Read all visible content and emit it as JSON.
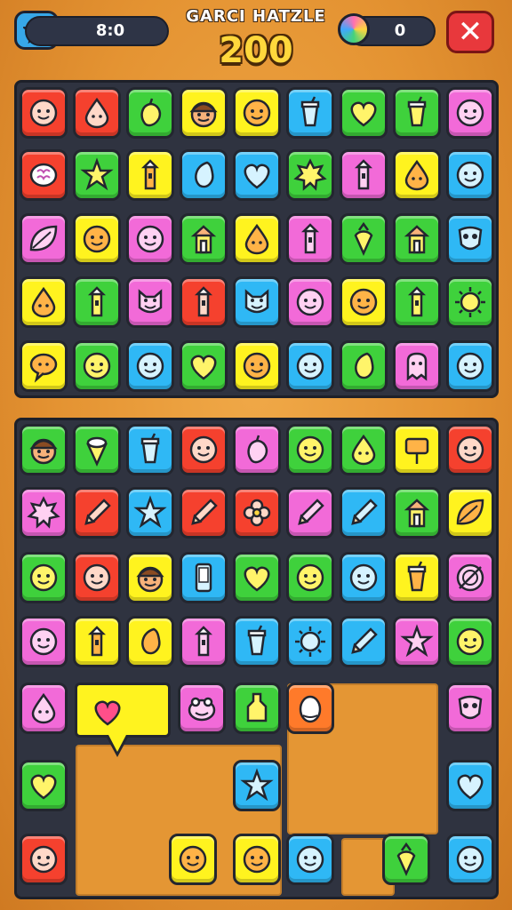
{
  "hud": {
    "title": "GARCI HATZLE",
    "score": "200",
    "coins": "8:0",
    "gems": "0",
    "icons": [
      "star-icon",
      "avatar-icon",
      "close-icon"
    ],
    "colors": {
      "score": "#ffd83c",
      "close": "#e8383c",
      "star_button": "#37a7e8",
      "star": "#ffd640"
    }
  },
  "palette": {
    "red": "#f5412e",
    "blue": "#2fb8f5",
    "green": "#3fd13c",
    "yellow": "#fff31f",
    "pink": "#f26ad8",
    "lime": "#8fe83a",
    "orange": "#ff7a2a"
  },
  "boards": {
    "top": {
      "rows": [
        [
          {
            "c": "red",
            "i": "face-icon"
          },
          {
            "c": "red",
            "i": "drop-icon"
          },
          {
            "c": "green",
            "i": "pepper-icon"
          },
          {
            "c": "yellow",
            "i": "boy-face-icon"
          },
          {
            "c": "yellow",
            "i": "face-icon"
          },
          {
            "c": "blue",
            "i": "cup-icon"
          },
          {
            "c": "green",
            "i": "heart-icon"
          },
          {
            "c": "green",
            "i": "cup-icon"
          },
          {
            "c": "pink",
            "i": "face-icon"
          }
        ],
        [
          {
            "c": "red",
            "i": "shell-icon"
          },
          {
            "c": "green",
            "i": "star-icon"
          },
          {
            "c": "yellow",
            "i": "tower-icon"
          },
          {
            "c": "blue",
            "i": "bean-icon"
          },
          {
            "c": "blue",
            "i": "heart-icon"
          },
          {
            "c": "green",
            "i": "burst-icon"
          },
          {
            "c": "pink",
            "i": "tower-icon"
          },
          {
            "c": "yellow",
            "i": "drop-icon"
          },
          {
            "c": "blue",
            "i": "face-icon"
          }
        ],
        [
          {
            "c": "pink",
            "i": "leaf-icon"
          },
          {
            "c": "yellow",
            "i": "face-icon"
          },
          {
            "c": "pink",
            "i": "face-icon"
          },
          {
            "c": "green",
            "i": "house-icon"
          },
          {
            "c": "yellow",
            "i": "drop-icon"
          },
          {
            "c": "pink",
            "i": "tower-icon"
          },
          {
            "c": "green",
            "i": "carrot-icon"
          },
          {
            "c": "green",
            "i": "house-icon"
          },
          {
            "c": "blue",
            "i": "mask-icon"
          }
        ],
        [
          {
            "c": "yellow",
            "i": "drop-icon"
          },
          {
            "c": "green",
            "i": "tower-icon"
          },
          {
            "c": "pink",
            "i": "cat-icon"
          },
          {
            "c": "red",
            "i": "tower-icon"
          },
          {
            "c": "blue",
            "i": "cat-icon"
          },
          {
            "c": "pink",
            "i": "face-icon"
          },
          {
            "c": "yellow",
            "i": "face-icon"
          },
          {
            "c": "green",
            "i": "tower-icon"
          },
          {
            "c": "green",
            "i": "sun-icon"
          }
        ],
        [
          {
            "c": "yellow",
            "i": "bubble-icon"
          },
          {
            "c": "green",
            "i": "face-icon"
          },
          {
            "c": "blue",
            "i": "face-icon"
          },
          {
            "c": "green",
            "i": "heart-icon"
          },
          {
            "c": "yellow",
            "i": "face-icon"
          },
          {
            "c": "blue",
            "i": "face-icon"
          },
          {
            "c": "green",
            "i": "bean-icon"
          },
          {
            "c": "pink",
            "i": "ghost-icon"
          },
          {
            "c": "blue",
            "i": "face-icon"
          }
        ]
      ]
    },
    "bottom": {
      "rows": [
        [
          {
            "c": "green",
            "i": "boy-face-icon"
          },
          {
            "c": "green",
            "i": "cone-icon"
          },
          {
            "c": "blue",
            "i": "cup-icon"
          },
          {
            "c": "red",
            "i": "face-icon"
          },
          {
            "c": "pink",
            "i": "pepper-icon"
          },
          {
            "c": "green",
            "i": "face-icon"
          },
          {
            "c": "green",
            "i": "drop-icon"
          },
          {
            "c": "yellow",
            "i": "sign-icon"
          },
          {
            "c": "red",
            "i": "face-icon"
          }
        ],
        [
          {
            "c": "pink",
            "i": "burst-icon"
          },
          {
            "c": "red",
            "i": "pencil-icon"
          },
          {
            "c": "blue",
            "i": "star-icon"
          },
          {
            "c": "red",
            "i": "pencil-icon"
          },
          {
            "c": "red",
            "i": "flower-icon"
          },
          {
            "c": "pink",
            "i": "pencil-icon"
          },
          {
            "c": "blue",
            "i": "pencil-icon"
          },
          {
            "c": "green",
            "i": "house-icon"
          },
          {
            "c": "yellow",
            "i": "leaf-icon"
          }
        ],
        [
          {
            "c": "green",
            "i": "face-icon"
          },
          {
            "c": "red",
            "i": "face-icon"
          },
          {
            "c": "yellow",
            "i": "boy-face-icon"
          },
          {
            "c": "blue",
            "i": "phone-icon"
          },
          {
            "c": "green",
            "i": "heart-icon"
          },
          {
            "c": "green",
            "i": "face-icon"
          },
          {
            "c": "blue",
            "i": "face-icon"
          },
          {
            "c": "yellow",
            "i": "cup-icon"
          },
          {
            "c": "pink",
            "i": "plate-icon"
          }
        ],
        [
          {
            "c": "pink",
            "i": "face-icon"
          },
          {
            "c": "yellow",
            "i": "tower-icon"
          },
          {
            "c": "yellow",
            "i": "bean-icon"
          },
          {
            "c": "pink",
            "i": "tower-icon"
          },
          {
            "c": "blue",
            "i": "cup-icon"
          },
          {
            "c": "blue",
            "i": "sun-icon"
          },
          {
            "c": "blue",
            "i": "pencil-icon"
          },
          {
            "c": "pink",
            "i": "star-icon"
          },
          {
            "c": "green",
            "i": "face-icon"
          }
        ]
      ],
      "loose": [
        {
          "c": "pink",
          "i": "drop-icon"
        },
        {
          "c": "pink",
          "i": "frog-icon"
        },
        {
          "c": "green",
          "i": "bottle-icon"
        },
        {
          "c": "orange",
          "i": "egg-icon"
        },
        {
          "c": "pink",
          "i": "mask-icon"
        },
        {
          "c": "green",
          "i": "heart-icon"
        },
        {
          "c": "blue",
          "i": "star-icon"
        },
        {
          "c": "blue",
          "i": "heart-icon"
        },
        {
          "c": "red",
          "i": "face-icon"
        },
        {
          "c": "yellow",
          "i": "face-icon"
        },
        {
          "c": "yellow",
          "i": "face-icon"
        },
        {
          "c": "blue",
          "i": "face-icon"
        },
        {
          "c": "green",
          "i": "carrot-icon"
        },
        {
          "c": "blue",
          "i": "face-icon"
        }
      ],
      "callout": {
        "c": "yellow",
        "i": "heart-icon"
      }
    }
  }
}
